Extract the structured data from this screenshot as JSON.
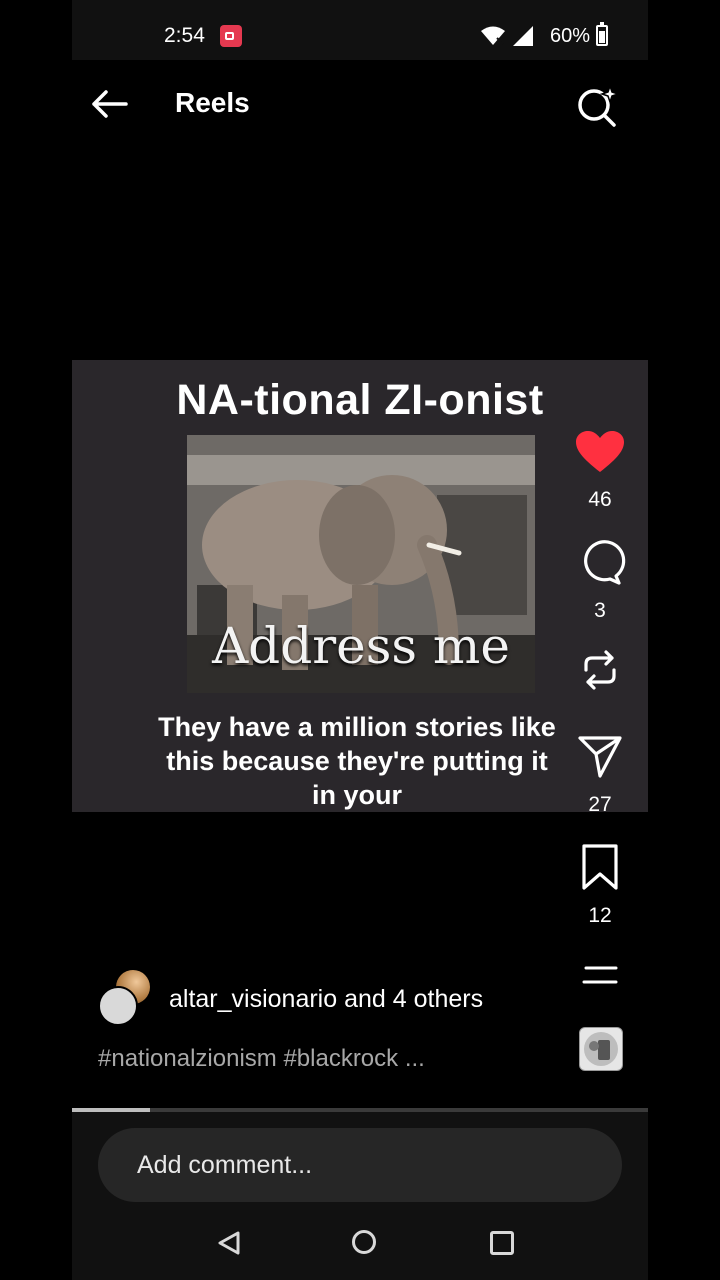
{
  "status_bar": {
    "time": "2:54",
    "battery": "60%"
  },
  "header": {
    "title": "Reels"
  },
  "video": {
    "title": "NA-tional ZI-onist",
    "image_text": "Address me",
    "caption": "They have a million stories like this because they're putting it in your"
  },
  "actions": {
    "likes": "46",
    "comments": "3",
    "shares": "27",
    "saves": "12"
  },
  "post": {
    "username": "altar_visionario",
    "and_text": "and",
    "others": "4 others",
    "hashtags": "#nationalzionism #blackrock ..."
  },
  "progress": {
    "fraction": 0.135
  },
  "comment": {
    "placeholder": "Add comment..."
  },
  "colors": {
    "like": "#ff3040",
    "background": "#000000"
  },
  "icons": [
    "back-arrow-icon",
    "sparkle-search-icon",
    "heart-icon",
    "comment-icon",
    "repost-icon",
    "send-icon",
    "bookmark-icon",
    "more-lines-icon"
  ]
}
